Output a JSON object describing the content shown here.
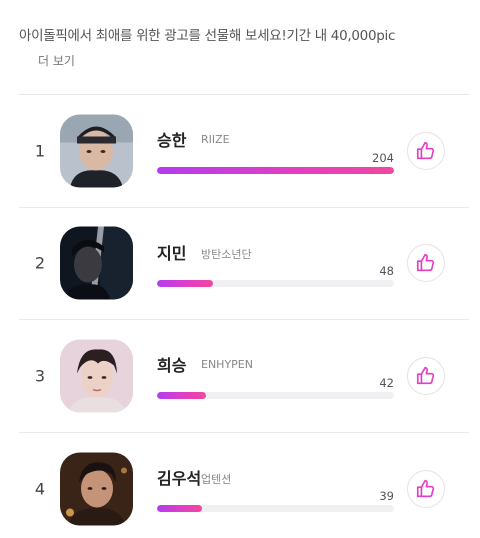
{
  "promo": {
    "text": "아이돌픽에서 최애를 위한 광고를 선물해 보세요!기간 내 40,000pic",
    "more_label": "더 보기"
  },
  "colors": {
    "bar_start": "#b33cf0",
    "bar_end": "#f0479f",
    "like_icon": "#e13fc7"
  },
  "ranking": [
    {
      "rank": "1",
      "name": "승한",
      "group": "RIIZE",
      "count": "204",
      "progress": 1.0,
      "avatar_icon": "person-photo"
    },
    {
      "rank": "2",
      "name": "지민",
      "group": "방탄소년단",
      "count": "48",
      "progress": 0.235,
      "avatar_icon": "person-photo"
    },
    {
      "rank": "3",
      "name": "희승",
      "group": "ENHYPEN",
      "count": "42",
      "progress": 0.206,
      "avatar_icon": "person-photo"
    },
    {
      "rank": "4",
      "name": "김우석",
      "group": "업텐션",
      "count": "39",
      "progress": 0.191,
      "avatar_icon": "person-photo"
    }
  ],
  "like_icon": "thumbs-up-icon"
}
